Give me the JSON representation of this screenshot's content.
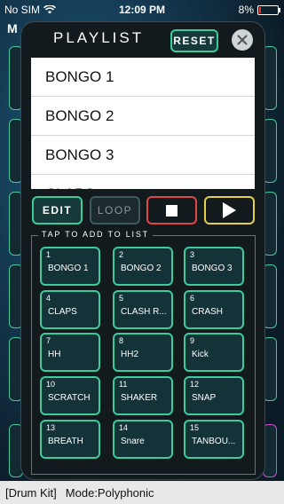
{
  "status_bar": {
    "carrier": "No SIM",
    "time": "12:09 PM",
    "battery": "8%"
  },
  "background": {
    "title_fragment": "M",
    "footer_kit": "[Drum Kit]",
    "footer_mode": "Mode:Polyphonic"
  },
  "playlist": {
    "title": "PLAYLIST",
    "reset_label": "RESET",
    "items": [
      "BONGO 1",
      "BONGO 2",
      "BONGO 3",
      "CLAPS"
    ],
    "controls": {
      "edit_label": "EDIT",
      "loop_label": "LOOP"
    },
    "add_section_label": "TAP TO ADD TO LIST",
    "pads": [
      {
        "num": "1",
        "name": "BONGO 1"
      },
      {
        "num": "2",
        "name": "BONGO 2"
      },
      {
        "num": "3",
        "name": "BONGO 3"
      },
      {
        "num": "4",
        "name": "CLAPS"
      },
      {
        "num": "5",
        "name": "CLASH R..."
      },
      {
        "num": "6",
        "name": "CRASH"
      },
      {
        "num": "7",
        "name": "HH"
      },
      {
        "num": "8",
        "name": "HH2"
      },
      {
        "num": "9",
        "name": "Kick"
      },
      {
        "num": "10",
        "name": "SCRATCH"
      },
      {
        "num": "11",
        "name": "SHAKER"
      },
      {
        "num": "12",
        "name": "SNAP"
      },
      {
        "num": "13",
        "name": "BREATH"
      },
      {
        "num": "14",
        "name": "Snare"
      },
      {
        "num": "15",
        "name": "TANBOU..."
      }
    ]
  },
  "colors": {
    "accent_green": "#3ccc9c",
    "stop_red": "#e04848",
    "play_yellow": "#e6d048"
  }
}
